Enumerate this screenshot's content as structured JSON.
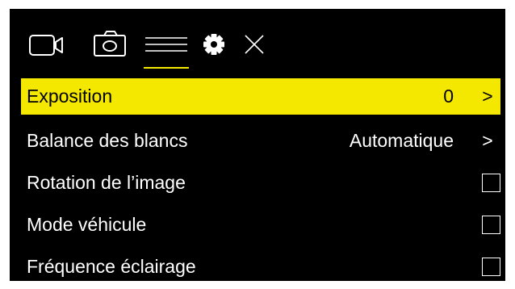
{
  "tabs": [
    {
      "icon": "video-camera-icon",
      "active": false
    },
    {
      "icon": "photo-camera-icon",
      "active": false
    },
    {
      "icon": "menu-icon",
      "active": true
    },
    {
      "icon": "gear-icon",
      "active": false
    },
    {
      "icon": "close-icon",
      "active": false
    }
  ],
  "colors": {
    "background": "#000000",
    "accent": "#f5e800",
    "text": "#ffffff",
    "selected_text": "#000000"
  },
  "menu": {
    "items": [
      {
        "label": "Exposition",
        "value": "0",
        "arrow": ">",
        "selected": true
      },
      {
        "label": "Balance des blancs",
        "value": "Automatique",
        "arrow": ">",
        "selected": false
      },
      {
        "label": "Rotation de l’image",
        "checked": false
      },
      {
        "label": "Mode véhicule",
        "checked": false
      },
      {
        "label": "Fréquence éclairage",
        "checked": false
      }
    ]
  }
}
